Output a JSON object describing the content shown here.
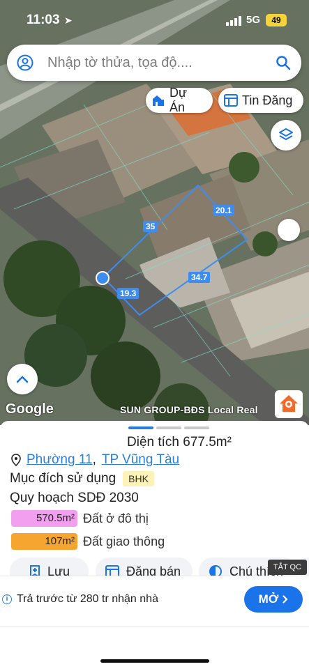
{
  "status": {
    "time": "11:03",
    "network": "5G",
    "battery": "49"
  },
  "search": {
    "placeholder": "Nhập tờ thửa, tọa độ...."
  },
  "chips": {
    "du_an": "Dự Án",
    "tin_dang": "Tin Đăng"
  },
  "map": {
    "dimensions": [
      "35",
      "20.1",
      "19.3",
      "34.7"
    ],
    "google": "Google",
    "watermark": "SUN GROUP-BĐS Local Real"
  },
  "parcel": {
    "area_text": "Diện tích 677.5m²",
    "ward": "Phường 11",
    "separator": ",",
    "city": "TP Vũng Tàu",
    "purpose_label": "Mục đích sử dụng",
    "purpose_code": "BHK",
    "plan_title": "Quy hoạch SDĐ 2030",
    "plans": [
      {
        "area": "570.5m²",
        "label": "Đất ở đô thị",
        "color": "#f29ff0"
      },
      {
        "area": "107m²",
        "label": "Đất giao thông",
        "color": "#f6a531"
      }
    ]
  },
  "actions": {
    "save": "Lưu",
    "sell": "Đăng bán",
    "legend": "Chú thích"
  },
  "ad": {
    "close": "TẮT QC",
    "text": "Trả trước từ 280 tr nhận nhà",
    "button": "MỞ",
    "info": "i"
  }
}
